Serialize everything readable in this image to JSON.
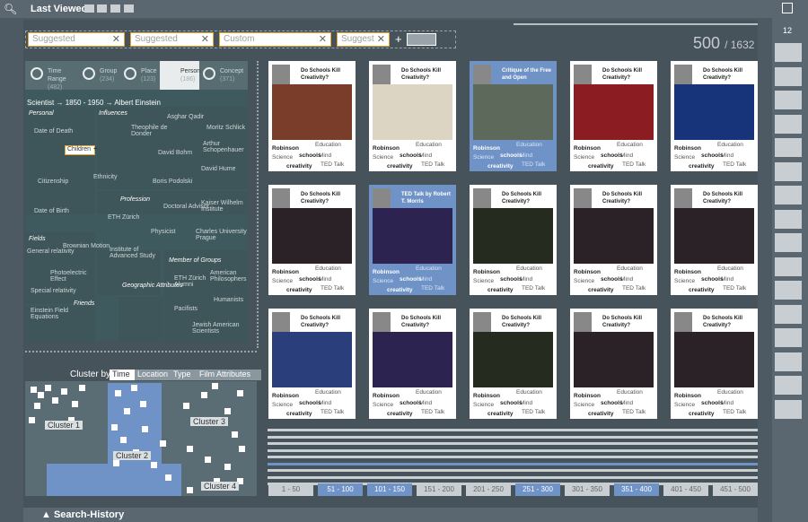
{
  "top": {
    "last_viewed": "Last Viewed:",
    "search_icon": "search-icon",
    "window_icon": "window-icon"
  },
  "search": {
    "fields": [
      "Suggested",
      "Suggested",
      "Custom",
      "Suggest"
    ],
    "add": "+",
    "count": "500",
    "total": "/ 1632"
  },
  "right_rail": {
    "number": "12"
  },
  "facet_tabs": [
    {
      "label": "Time Range",
      "count": "(482)"
    },
    {
      "label": "Group",
      "count": "(234)"
    },
    {
      "label": "Place",
      "count": "(123)"
    },
    {
      "label": "Person",
      "count": "(186)"
    },
    {
      "label": "Concept",
      "count": "(371)"
    }
  ],
  "breadcrumb": {
    "a": "Scientist",
    "b": "1850 - 1950",
    "c": "Albert Einstein"
  },
  "facets": {
    "headers": [
      "Personal",
      "Influences",
      "Fields",
      "Friends",
      "Geographic Attributes",
      "Member of Groups",
      "Profession"
    ],
    "items": [
      "Date of Death",
      "Asghar Qadir",
      "Theophile de Donder",
      "Moritz Schlick",
      "Arthur Schopenhauer",
      "David Bohm",
      "David Hume",
      "Ethnicity",
      "Citizenship",
      "Boris Podolski",
      "Date of Birth",
      "Doctoral Advisor",
      "Kaiser Wilhelm Institute",
      "ETH Zürich",
      "Physicist",
      "Charles University Prague",
      "General relativity",
      "Brownian Motion",
      "Institute of Advanced Study",
      "Photoelectric Effect",
      "ETH Zürich Alumni",
      "American Philosophers",
      "Special relativity",
      "Humanists",
      "Einstein Field Equations",
      "Pacifists",
      "Jewish American Scientists"
    ],
    "children": "Children",
    "children_plus": "+"
  },
  "cluster": {
    "label": "Cluster by",
    "tabs": [
      "Time",
      "Location",
      "Type",
      "Film Attributes"
    ],
    "clusters": [
      "Cluster 1",
      "Cluster 2",
      "Cluster 3",
      "Cluster 4"
    ]
  },
  "films": [
    {
      "title": "Do Schools Kill Creativity?",
      "selected": false,
      "bg": "#7a3d2a"
    },
    {
      "title": "Do Schools Kill Creativity?",
      "selected": false,
      "bg": "#ddd5c4"
    },
    {
      "title": "Critique of the Free and Open",
      "selected": true,
      "bg": "#5d6a5b"
    },
    {
      "title": "Do Schools Kill Creativity?",
      "selected": false,
      "bg": "#8a1c22"
    },
    {
      "title": "Do Schools Kill Creativity?",
      "selected": false,
      "bg": "#17337a"
    },
    {
      "title": "Do Schools Kill Creativity?",
      "selected": false,
      "bg": "#2a2226"
    },
    {
      "title": "TED Talk by Robert T. Morris",
      "selected": true,
      "bg": "#2c2350"
    },
    {
      "title": "Do Schools Kill Creativity?",
      "selected": false,
      "bg": "#262b20"
    },
    {
      "title": "Do Schools Kill Creativity?",
      "selected": false,
      "bg": "#2a2226"
    },
    {
      "title": "Do Schools Kill Creativity?",
      "selected": false,
      "bg": "#2a2226"
    },
    {
      "title": "Do Schools Kill Creativity?",
      "selected": false,
      "bg": "#2b3e7c"
    },
    {
      "title": "Do Schools Kill Creativity?",
      "selected": false,
      "bg": "#2c2350"
    },
    {
      "title": "Do Schools Kill Creativity?",
      "selected": false,
      "bg": "#262b20"
    },
    {
      "title": "Do Schools Kill Creativity?",
      "selected": false,
      "bg": "#2a2226"
    },
    {
      "title": "Do Schools Kill Creativity?",
      "selected": false,
      "bg": "#2a2226"
    }
  ],
  "tags": [
    "Robinson",
    "Education",
    "Science",
    "schools",
    "Mind",
    "creativity",
    "TED Talk"
  ],
  "pages": [
    {
      "label": "1 - 50",
      "on": false
    },
    {
      "label": "51 - 100",
      "on": true
    },
    {
      "label": "101 - 150",
      "on": true
    },
    {
      "label": "151 - 200",
      "on": false
    },
    {
      "label": "201 - 250",
      "on": false
    },
    {
      "label": "251 - 300",
      "on": true
    },
    {
      "label": "301 - 350",
      "on": false
    },
    {
      "label": "351 - 400",
      "on": true
    },
    {
      "label": "401 - 450",
      "on": false
    },
    {
      "label": "451 - 500",
      "on": false
    }
  ],
  "bottom": {
    "label": "▲ Search-History"
  },
  "colors": {
    "accent": "#6f93c7",
    "highlight": "#e3a632"
  }
}
